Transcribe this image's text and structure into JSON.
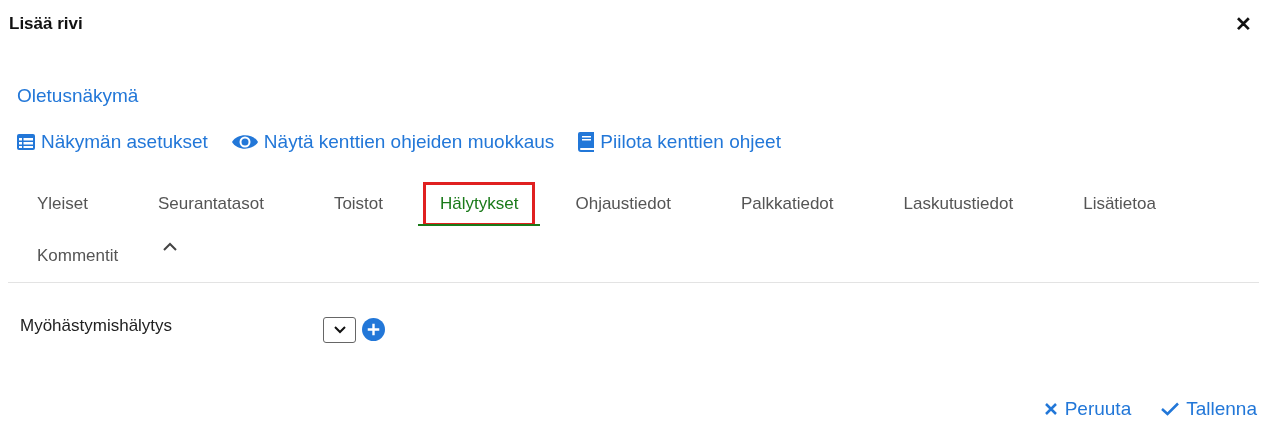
{
  "dialog": {
    "title": "Lisää rivi",
    "close": "✕"
  },
  "view_link": "Oletusnäkymä",
  "toolbar": [
    {
      "kind": "table",
      "label": "Näkymän asetukset"
    },
    {
      "kind": "eye",
      "label": "Näytä kenttien ohjeiden muokkaus"
    },
    {
      "kind": "book",
      "label": "Piilota kenttien ohjeet"
    }
  ],
  "tabs": [
    {
      "label": "Yleiset",
      "selected": false,
      "outlined": false
    },
    {
      "label": "Seurantatasot",
      "selected": false,
      "outlined": false
    },
    {
      "label": "Toistot",
      "selected": false,
      "outlined": false
    },
    {
      "label": "Hälytykset",
      "selected": true,
      "outlined": true
    },
    {
      "label": "Ohjaustiedot",
      "selected": false,
      "outlined": false
    },
    {
      "label": "Palkkatiedot",
      "selected": false,
      "outlined": false
    },
    {
      "label": "Laskutustiedot",
      "selected": false,
      "outlined": false
    },
    {
      "label": "Lisätietoa",
      "selected": false,
      "outlined": false
    },
    {
      "label": "Kommentit",
      "selected": false,
      "outlined": false
    }
  ],
  "tabs_expanded": true,
  "fields": [
    {
      "label": "Myöhästymishälytys"
    }
  ],
  "footer": [
    {
      "kind": "cancel",
      "label": "Peruuta"
    },
    {
      "kind": "save",
      "label": "Tallenna"
    }
  ]
}
